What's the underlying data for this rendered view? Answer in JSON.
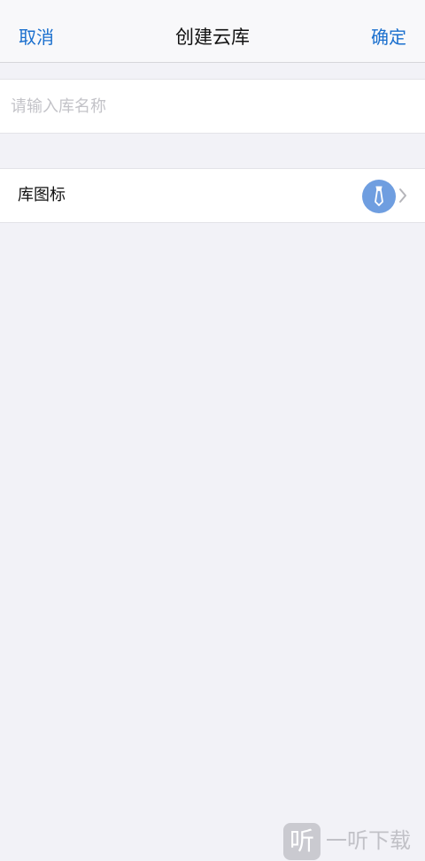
{
  "nav": {
    "cancel_label": "取消",
    "title": "创建云库",
    "confirm_label": "确定"
  },
  "form": {
    "name_placeholder": "请输入库名称",
    "name_value": "",
    "icon_label": "库图标",
    "icon_badge_icon": "tie-icon",
    "icon_badge_color": "#6f9ee0"
  },
  "watermark": {
    "logo_char": "听",
    "text": "一听下载"
  },
  "colors": {
    "accent": "#1a6fce",
    "background": "#f2f2f7"
  }
}
